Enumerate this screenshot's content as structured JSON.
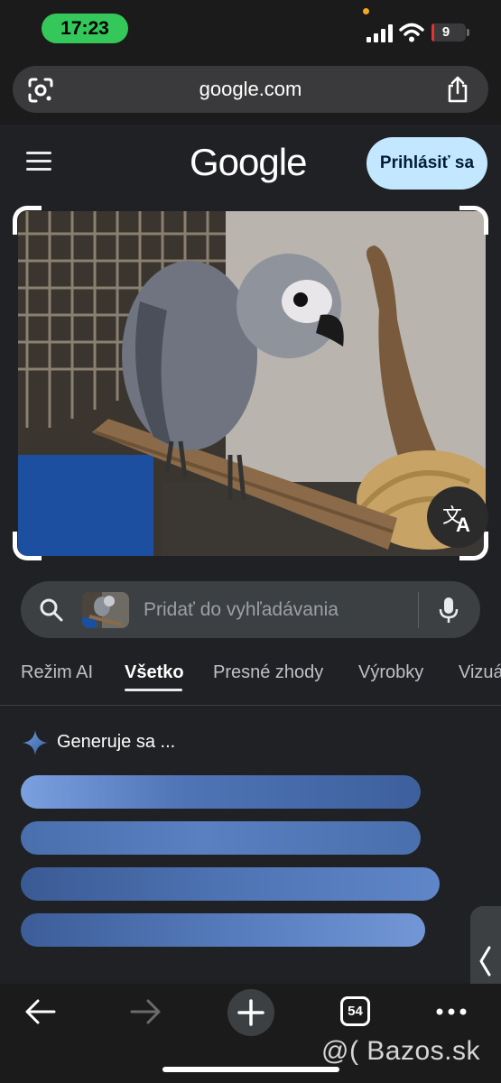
{
  "status_bar": {
    "time": "17:23",
    "battery": "9",
    "battery_level": 0.09,
    "icons": [
      "signal-icon",
      "wifi-icon",
      "battery-icon"
    ]
  },
  "browser": {
    "url": "google.com",
    "lens_icon": "lens-icon",
    "share_icon": "share-icon"
  },
  "google_header": {
    "logo": "Google",
    "sign_in_label": "Prihlásiť sa",
    "menu_icon": "hamburger-menu-icon"
  },
  "image_search": {
    "photo_icon": "uploaded-parrot-photo",
    "translate_icon": "translate-icon"
  },
  "search": {
    "placeholder": "Pridať do vyhľadávania",
    "value": "",
    "mic_icon": "mic-icon"
  },
  "tabs": [
    {
      "label": "Režim AI",
      "active": false
    },
    {
      "label": "Všetko",
      "active": true
    },
    {
      "label": "Presné zhody",
      "active": false
    },
    {
      "label": "Výrobky",
      "active": false
    },
    {
      "label": "Vizuá",
      "active": false
    }
  ],
  "ai_overview": {
    "status": "Generuje sa",
    "ellipsis": "..."
  },
  "toolbar": {
    "tab_count": "54",
    "icons": [
      "back-arrow-icon",
      "forward-arrow-icon",
      "plus-icon",
      "tabs-icon",
      "more-icon"
    ]
  },
  "watermark": "@( Bazos.sk",
  "colors": {
    "accent_signin": "#c2e7ff",
    "time_pill": "#34c759",
    "battery_low": "#e5352b",
    "bar_blue": "#5277b8"
  }
}
